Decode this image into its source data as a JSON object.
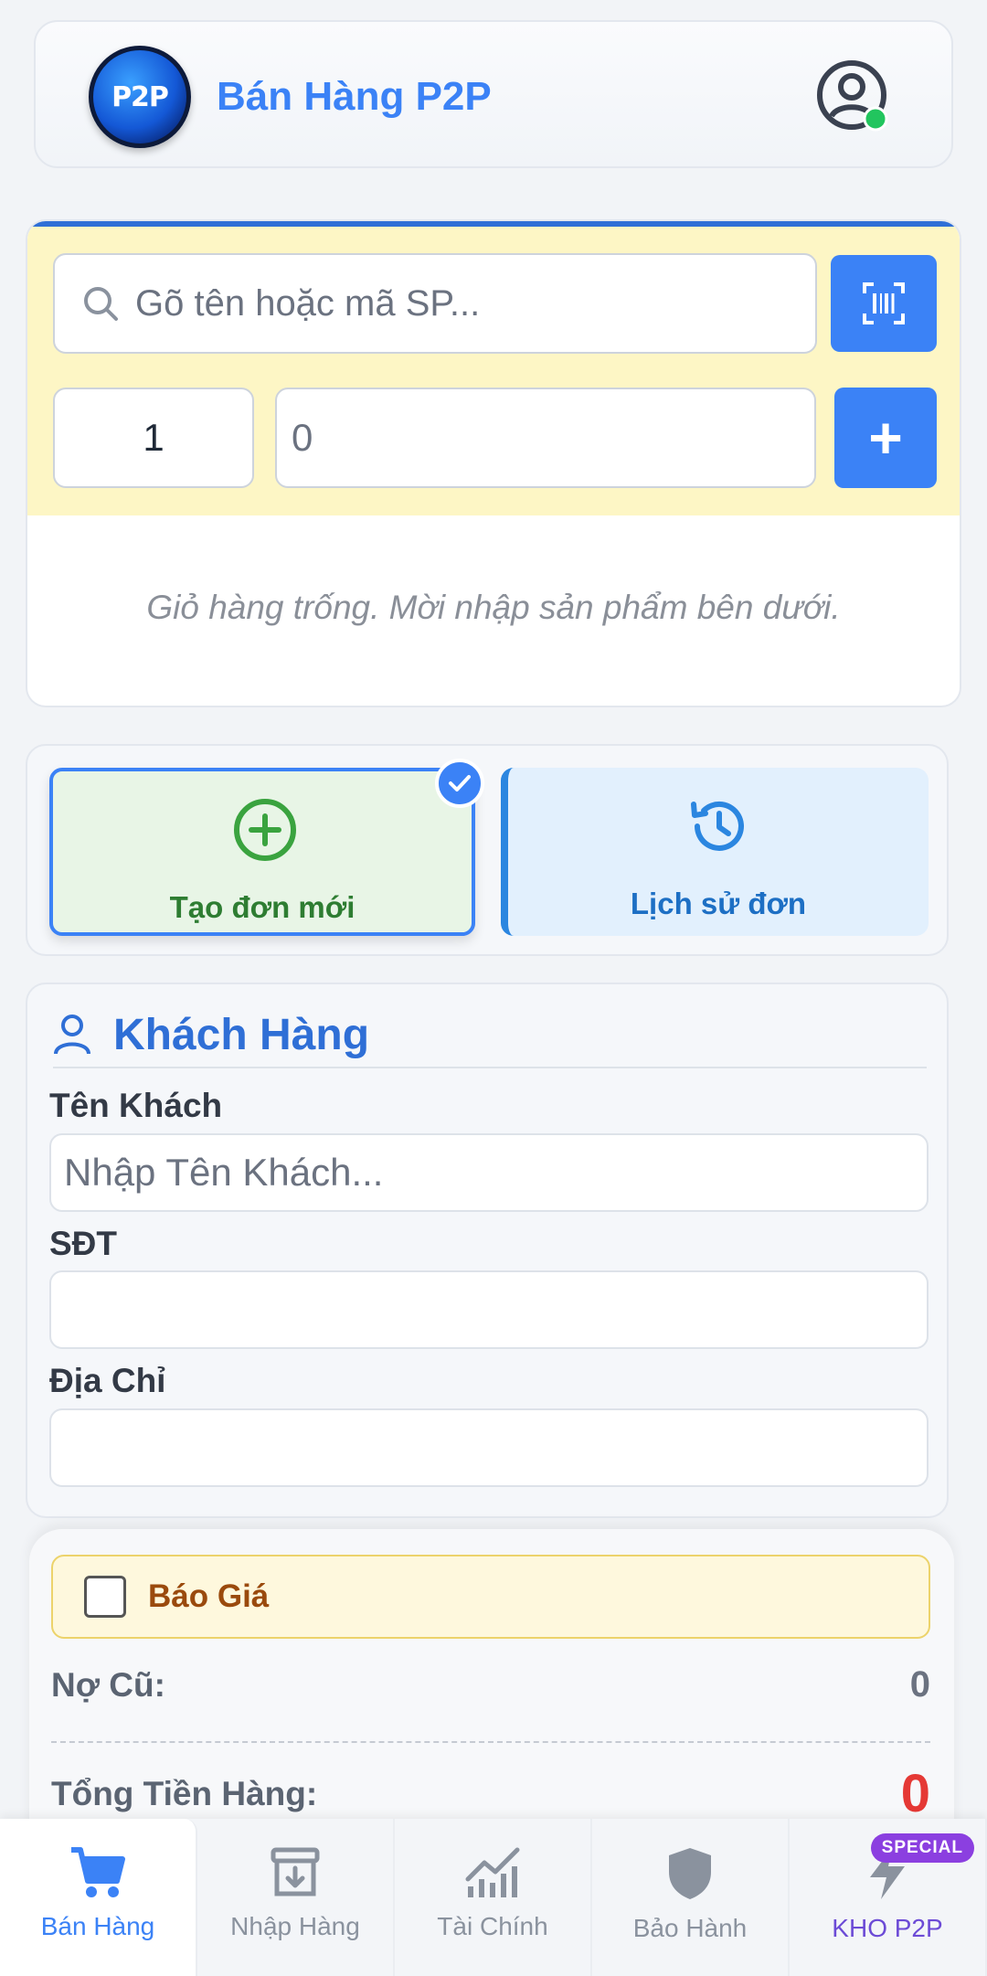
{
  "header": {
    "logo_text": "P2P",
    "title": "Bán Hàng P2P",
    "online_color": "#22c55e"
  },
  "search": {
    "placeholder": "Gõ tên hoặc mã SP...",
    "quantity": "1",
    "price": "0",
    "add_label": "+",
    "empty_cart_text": "Giỏ hàng trống. Mời nhập sản phẩm bên dưới."
  },
  "order_mode": {
    "new_label": "Tạo đơn mới",
    "history_label": "Lịch sử đơn",
    "selected": "new"
  },
  "customer": {
    "title": "Khách Hàng",
    "name_label": "Tên Khách",
    "name_placeholder": "Nhập Tên Khách...",
    "phone_label": "SĐT",
    "phone_value": "",
    "address_label": "Địa Chỉ",
    "address_value": ""
  },
  "summary": {
    "quote_label": "Báo Giá",
    "quote_checked": false,
    "old_debt_label": "Nợ Cũ:",
    "old_debt_value": "0",
    "total_label": "Tổng Tiền Hàng:",
    "total_value": "0"
  },
  "nav": {
    "items": [
      {
        "label": "Bán Hàng",
        "icon": "cart-icon",
        "active": true
      },
      {
        "label": "Nhập Hàng",
        "icon": "archive-download-icon",
        "active": false
      },
      {
        "label": "Tài Chính",
        "icon": "chart-icon",
        "active": false
      },
      {
        "label": "Bảo Hành",
        "icon": "shield-icon",
        "active": false
      },
      {
        "label": "KHO P2P",
        "icon": "lightning-icon",
        "active": false,
        "badge": "SPECIAL"
      }
    ]
  },
  "colors": {
    "accent": "#3b82f6",
    "success": "#2e7d32",
    "danger": "#e53935",
    "special": "#8b3fe0"
  }
}
